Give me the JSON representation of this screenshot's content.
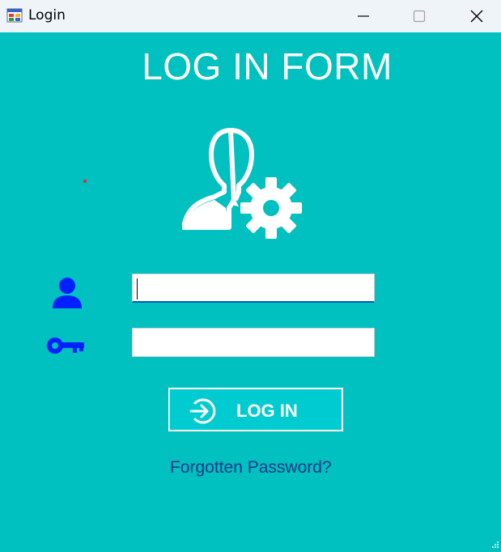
{
  "window": {
    "title": "Login"
  },
  "form": {
    "title": "LOG IN FORM",
    "username": {
      "value": "",
      "placeholder": ""
    },
    "password": {
      "value": "",
      "placeholder": ""
    },
    "login_label": "LOG IN",
    "forgot_label": "Forgotten Password?"
  },
  "icons": {
    "header": "user-gear-icon",
    "username": "user-icon",
    "password": "key-icon",
    "login": "arrow-right-circle-icon"
  },
  "colors": {
    "background": "#00c0c0",
    "button": "#00cbd0",
    "field_icon": "#0020ff",
    "link": "#1a3a8a"
  }
}
